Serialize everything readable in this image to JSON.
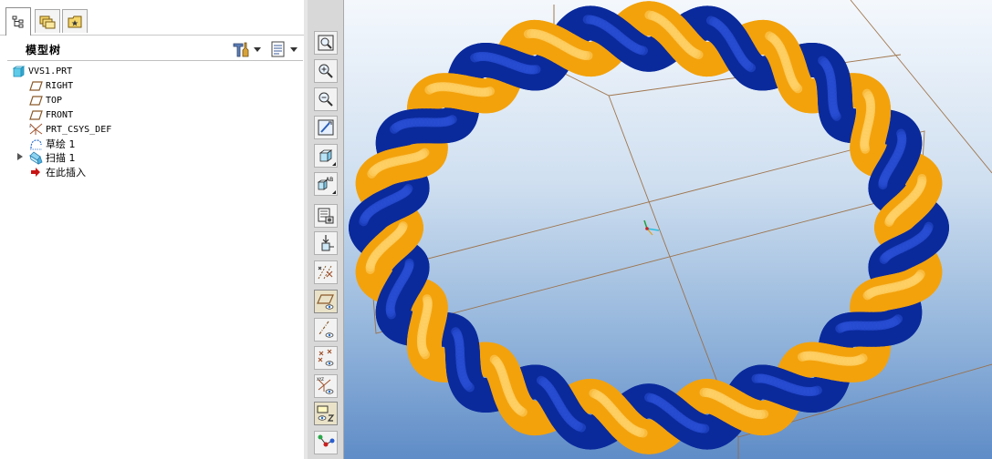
{
  "model_tree": {
    "title": "模型树",
    "items": [
      {
        "label": "VVS1.PRT",
        "icon": "part-icon"
      },
      {
        "label": "RIGHT",
        "icon": "datum-plane-icon"
      },
      {
        "label": "TOP",
        "icon": "datum-plane-icon"
      },
      {
        "label": "FRONT",
        "icon": "datum-plane-icon"
      },
      {
        "label": "PRT_CSYS_DEF",
        "icon": "coordinate-system-icon"
      },
      {
        "label": "草绘 1",
        "icon": "sketch-icon"
      },
      {
        "label": "扫描 1",
        "icon": "sweep-icon"
      },
      {
        "label": "在此插入",
        "icon": "insert-here-arrow-icon"
      }
    ]
  },
  "tabs": [
    {
      "name": "model-tree-tab",
      "icon": "tree-icon"
    },
    {
      "name": "folder-browser-tab",
      "icon": "folders-icon"
    },
    {
      "name": "favorites-tab",
      "icon": "favorites-icon"
    }
  ],
  "toolbar": [
    {
      "name": "zoom-fit-button",
      "icon": "zoom-fit-icon"
    },
    {
      "name": "zoom-in-button",
      "icon": "zoom-in-icon"
    },
    {
      "name": "zoom-out-button",
      "icon": "zoom-out-icon"
    },
    {
      "name": "repaint-button",
      "icon": "repaint-icon"
    },
    {
      "name": "display-style-button",
      "icon": "cube-icon"
    },
    {
      "name": "saved-views-button",
      "icon": "saved-views-icon"
    },
    {
      "name": "view-manager-button",
      "icon": "view-manager-icon"
    },
    {
      "name": "orient-button",
      "icon": "orient-icon"
    },
    {
      "name": "datum-display-button",
      "icon": "datum-display-icon"
    },
    {
      "name": "plane-display-button",
      "icon": "plane-display-icon"
    },
    {
      "name": "axis-display-button",
      "icon": "axis-display-icon"
    },
    {
      "name": "point-display-button",
      "icon": "point-display-icon"
    },
    {
      "name": "csys-display-button",
      "icon": "csys-display-icon"
    },
    {
      "name": "annotation-display-button",
      "icon": "annotation-display-icon"
    },
    {
      "name": "spin-center-button",
      "icon": "spin-center-icon"
    }
  ],
  "toolbar_text": {
    "ab_label": "AB",
    "xyz_label": "XYZ"
  },
  "colors": {
    "blue_strand": "#0a2a9c",
    "yellow_strand": "#f3a20c",
    "viewport_top": "#f4f8fd",
    "viewport_bottom": "#5f8cc7",
    "datum_plane": "#9a6a3c"
  }
}
